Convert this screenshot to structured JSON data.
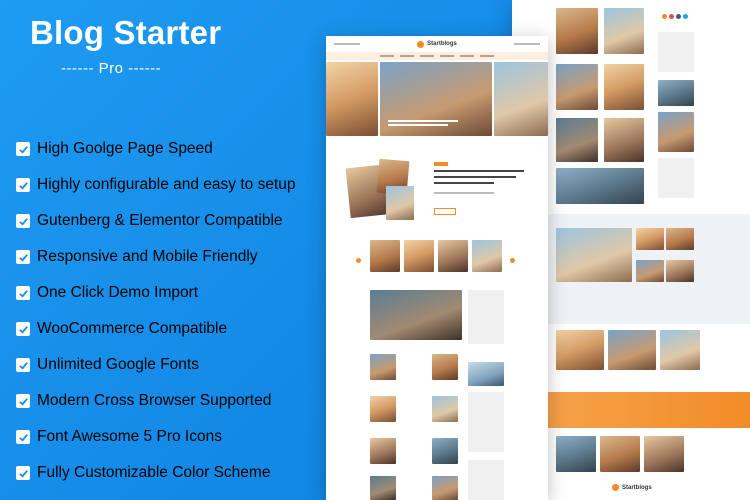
{
  "hero": {
    "title": "Blog Starter",
    "subtitle": "------ Pro ------"
  },
  "features": [
    "High Goolge Page Speed",
    "Highly configurable and easy to setup",
    "Gutenberg & Elementor Compatible",
    "Responsive and Mobile Friendly",
    "One Click Demo Import",
    "WooCommerce Compatible",
    "Unlimited Google Fonts",
    "Modern Cross Browser Supported",
    "Font Awesome 5 Pro Icons",
    "Fully Customizable Color Scheme"
  ],
  "mockup": {
    "logo_text": "Startblogs",
    "accent_color": "#f28c28",
    "background_color": "#1e9bf2"
  }
}
